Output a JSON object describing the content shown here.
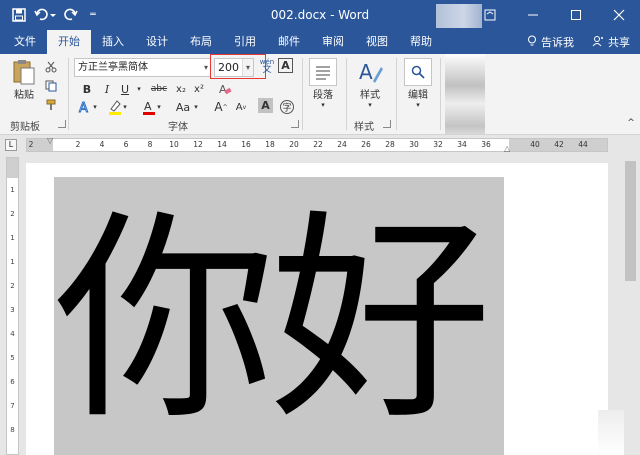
{
  "window": {
    "title": "002.docx  -  Word",
    "icons": {
      "save": "save-icon",
      "undo": "undo-icon",
      "redo": "redo-icon",
      "customize": "customize-qat-icon"
    }
  },
  "tabs": [
    {
      "label": "文件",
      "active": false
    },
    {
      "label": "开始",
      "active": true
    },
    {
      "label": "插入",
      "active": false
    },
    {
      "label": "设计",
      "active": false
    },
    {
      "label": "布局",
      "active": false
    },
    {
      "label": "引用",
      "active": false
    },
    {
      "label": "邮件",
      "active": false
    },
    {
      "label": "审阅",
      "active": false
    },
    {
      "label": "视图",
      "active": false
    },
    {
      "label": "帮助",
      "active": false
    }
  ],
  "tabs_right": {
    "tell_me": "告诉我",
    "share": "共享"
  },
  "ribbon": {
    "clipboard": {
      "paste_label": "粘贴",
      "group_label": "剪贴板"
    },
    "font": {
      "font_name": "方正兰亭黑简体",
      "font_size": "200",
      "group_label": "字体",
      "style_buttons": [
        "B",
        "I",
        "U",
        "abc",
        "x₂",
        "x²"
      ],
      "aa_label": "Aa"
    },
    "paragraph": {
      "label": "段落"
    },
    "styles": {
      "label": "样式",
      "group_label": "样式"
    },
    "editing": {
      "label": "编辑"
    }
  },
  "ruler": {
    "ticks": [
      "2",
      "2",
      "4",
      "6",
      "8",
      "10",
      "12",
      "14",
      "16",
      "18",
      "20",
      "22",
      "24",
      "26",
      "28",
      "30",
      "32",
      "34",
      "36",
      "40",
      "42",
      "44"
    ],
    "vticks": [
      "1",
      "2",
      "1",
      "1",
      "2",
      "3",
      "4",
      "5",
      "6",
      "7",
      "8",
      "9",
      "10",
      "11",
      "12",
      "13",
      "14"
    ]
  },
  "document": {
    "text": "你好"
  }
}
